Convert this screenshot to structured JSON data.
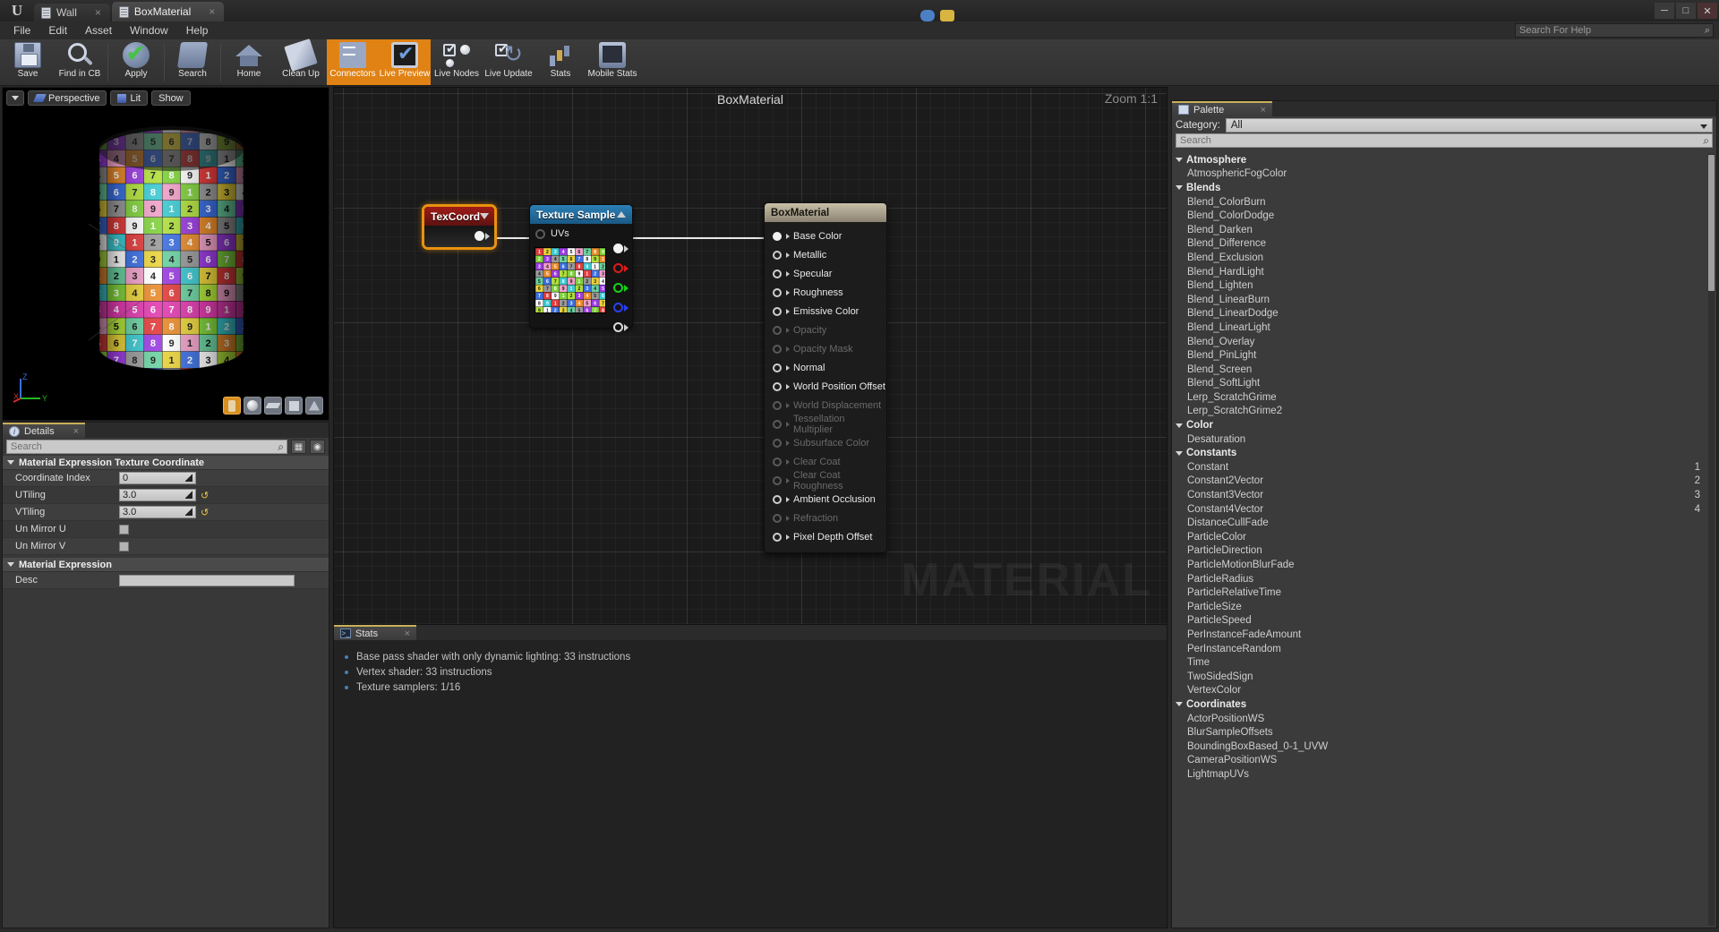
{
  "titlebar": {
    "logo": "ue-logo",
    "tabs": [
      {
        "label": "Wall",
        "close": "×",
        "active": false
      },
      {
        "label": "BoxMaterial",
        "close": "×",
        "active": true
      }
    ],
    "window_buttons": {
      "minimize": "─",
      "maximize": "□",
      "close": "✕"
    }
  },
  "menubar": {
    "items": [
      "File",
      "Edit",
      "Asset",
      "Window",
      "Help"
    ],
    "help_search_placeholder": "Search For Help",
    "help_search_value": ""
  },
  "toolbar": {
    "buttons": [
      {
        "label": "Save",
        "icon": "save-icon",
        "active": false
      },
      {
        "label": "Find in CB",
        "icon": "find-in-cb-icon",
        "active": false
      },
      {
        "label": "Apply",
        "icon": "apply-check-icon",
        "active": false
      },
      {
        "label": "Search",
        "icon": "search-binocular-icon",
        "active": false
      },
      {
        "label": "Home",
        "icon": "home-icon",
        "active": false
      },
      {
        "label": "Clean Up",
        "icon": "clean-up-broom-icon",
        "active": false
      },
      {
        "label": "Connectors",
        "icon": "connectors-icon",
        "active": true
      },
      {
        "label": "Live Preview",
        "icon": "live-preview-icon",
        "active": true
      },
      {
        "label": "Live Nodes",
        "icon": "live-nodes-icon",
        "active": false
      },
      {
        "label": "Live Update",
        "icon": "live-update-icon",
        "active": false
      },
      {
        "label": "Stats",
        "icon": "stats-bars-icon",
        "active": false
      },
      {
        "label": "Mobile Stats",
        "icon": "mobile-stats-icon",
        "active": false
      }
    ]
  },
  "viewport": {
    "view_mode_arrow": "view-options-arrow",
    "perspective_label": "Perspective",
    "lit_label": "Lit",
    "show_label": "Show",
    "axes": {
      "x": "X",
      "y": "Y",
      "z": "Z"
    },
    "preview_shapes": [
      "cylinder",
      "sphere",
      "plane",
      "cube",
      "custom-mesh"
    ]
  },
  "details": {
    "tab_title": "Details",
    "tab_close": "×",
    "search_placeholder": "Search",
    "groups": [
      {
        "title": "Material Expression Texture Coordinate",
        "props": [
          {
            "name": "Coordinate Index",
            "value": "0",
            "type": "number",
            "reset": false
          },
          {
            "name": "UTiling",
            "value": "3.0",
            "type": "number",
            "reset": true
          },
          {
            "name": "VTiling",
            "value": "3.0",
            "type": "number",
            "reset": true
          },
          {
            "name": "Un Mirror U",
            "value": "",
            "type": "checkbox",
            "reset": false
          },
          {
            "name": "Un Mirror V",
            "value": "",
            "type": "checkbox",
            "reset": false
          }
        ]
      },
      {
        "title": "Material Expression",
        "props": [
          {
            "name": "Desc",
            "value": "",
            "type": "text",
            "reset": false
          }
        ]
      }
    ]
  },
  "graph": {
    "title": "BoxMaterial",
    "zoom_label": "Zoom 1:1",
    "watermark": "MATERIAL",
    "nodes": {
      "texcoord": {
        "title": "TexCoord",
        "caret": "collapse-down",
        "selected": true
      },
      "texture_sample": {
        "title": "Texture Sample",
        "caret": "collapse-up",
        "input_pin": "UVs",
        "output_pins": [
          "RGB",
          "R",
          "G",
          "B",
          "A"
        ]
      },
      "box_material": {
        "title": "BoxMaterial",
        "pins": [
          {
            "label": "Base Color",
            "enabled": true,
            "connected": true
          },
          {
            "label": "Metallic",
            "enabled": true,
            "connected": false
          },
          {
            "label": "Specular",
            "enabled": true,
            "connected": false
          },
          {
            "label": "Roughness",
            "enabled": true,
            "connected": false
          },
          {
            "label": "Emissive Color",
            "enabled": true,
            "connected": false
          },
          {
            "label": "Opacity",
            "enabled": false,
            "connected": false
          },
          {
            "label": "Opacity Mask",
            "enabled": false,
            "connected": false
          },
          {
            "label": "Normal",
            "enabled": true,
            "connected": false
          },
          {
            "label": "World Position Offset",
            "enabled": true,
            "connected": false
          },
          {
            "label": "World Displacement",
            "enabled": false,
            "connected": false
          },
          {
            "label": "Tessellation Multiplier",
            "enabled": false,
            "connected": false
          },
          {
            "label": "Subsurface Color",
            "enabled": false,
            "connected": false
          },
          {
            "label": "Clear Coat",
            "enabled": false,
            "connected": false
          },
          {
            "label": "Clear Coat Roughness",
            "enabled": false,
            "connected": false
          },
          {
            "label": "Ambient Occlusion",
            "enabled": true,
            "connected": false
          },
          {
            "label": "Refraction",
            "enabled": false,
            "connected": false
          },
          {
            "label": "Pixel Depth Offset",
            "enabled": true,
            "connected": false
          }
        ]
      }
    }
  },
  "stats": {
    "tab_title": "Stats",
    "tab_close": "×",
    "lines": [
      "Base pass shader with only dynamic lighting: 33 instructions",
      "Vertex shader: 33 instructions",
      "Texture samplers: 1/16"
    ]
  },
  "palette": {
    "tab_title": "Palette",
    "tab_close": "×",
    "category_label": "Category:",
    "category_value": "All",
    "search_placeholder": "Search",
    "entries": [
      {
        "kind": "category",
        "label": "Atmosphere"
      },
      {
        "kind": "item",
        "label": "AtmosphericFogColor",
        "num": ""
      },
      {
        "kind": "category",
        "label": "Blends"
      },
      {
        "kind": "item",
        "label": "Blend_ColorBurn",
        "num": ""
      },
      {
        "kind": "item",
        "label": "Blend_ColorDodge",
        "num": ""
      },
      {
        "kind": "item",
        "label": "Blend_Darken",
        "num": ""
      },
      {
        "kind": "item",
        "label": "Blend_Difference",
        "num": ""
      },
      {
        "kind": "item",
        "label": "Blend_Exclusion",
        "num": ""
      },
      {
        "kind": "item",
        "label": "Blend_HardLight",
        "num": ""
      },
      {
        "kind": "item",
        "label": "Blend_Lighten",
        "num": ""
      },
      {
        "kind": "item",
        "label": "Blend_LinearBurn",
        "num": ""
      },
      {
        "kind": "item",
        "label": "Blend_LinearDodge",
        "num": ""
      },
      {
        "kind": "item",
        "label": "Blend_LinearLight",
        "num": ""
      },
      {
        "kind": "item",
        "label": "Blend_Overlay",
        "num": ""
      },
      {
        "kind": "item",
        "label": "Blend_PinLight",
        "num": ""
      },
      {
        "kind": "item",
        "label": "Blend_Screen",
        "num": ""
      },
      {
        "kind": "item",
        "label": "Blend_SoftLight",
        "num": ""
      },
      {
        "kind": "item",
        "label": "Lerp_ScratchGrime",
        "num": ""
      },
      {
        "kind": "item",
        "label": "Lerp_ScratchGrime2",
        "num": ""
      },
      {
        "kind": "category",
        "label": "Color"
      },
      {
        "kind": "item",
        "label": "Desaturation",
        "num": ""
      },
      {
        "kind": "category",
        "label": "Constants"
      },
      {
        "kind": "item",
        "label": "Constant",
        "num": "1"
      },
      {
        "kind": "item",
        "label": "Constant2Vector",
        "num": "2"
      },
      {
        "kind": "item",
        "label": "Constant3Vector",
        "num": "3"
      },
      {
        "kind": "item",
        "label": "Constant4Vector",
        "num": "4"
      },
      {
        "kind": "item",
        "label": "DistanceCullFade",
        "num": ""
      },
      {
        "kind": "item",
        "label": "ParticleColor",
        "num": ""
      },
      {
        "kind": "item",
        "label": "ParticleDirection",
        "num": ""
      },
      {
        "kind": "item",
        "label": "ParticleMotionBlurFade",
        "num": ""
      },
      {
        "kind": "item",
        "label": "ParticleRadius",
        "num": ""
      },
      {
        "kind": "item",
        "label": "ParticleRelativeTime",
        "num": ""
      },
      {
        "kind": "item",
        "label": "ParticleSize",
        "num": ""
      },
      {
        "kind": "item",
        "label": "ParticleSpeed",
        "num": ""
      },
      {
        "kind": "item",
        "label": "PerInstanceFadeAmount",
        "num": ""
      },
      {
        "kind": "item",
        "label": "PerInstanceRandom",
        "num": ""
      },
      {
        "kind": "item",
        "label": "Time",
        "num": ""
      },
      {
        "kind": "item",
        "label": "TwoSidedSign",
        "num": ""
      },
      {
        "kind": "item",
        "label": "VertexColor",
        "num": ""
      },
      {
        "kind": "category",
        "label": "Coordinates"
      },
      {
        "kind": "item",
        "label": "ActorPositionWS",
        "num": ""
      },
      {
        "kind": "item",
        "label": "BlurSampleOffsets",
        "num": ""
      },
      {
        "kind": "item",
        "label": "BoundingBoxBased_0-1_UVW",
        "num": ""
      },
      {
        "kind": "item",
        "label": "CameraPositionWS",
        "num": ""
      },
      {
        "kind": "item",
        "label": "LightmapUVs",
        "num": ""
      }
    ]
  },
  "colors": {
    "accent_orange": "#e08214",
    "node_texcoord_header": "#a01c18",
    "node_texsample_header": "#2c7fb5",
    "node_material_header": "#c8bfa8",
    "pin_red": "#e01b1b",
    "pin_green": "#14d214",
    "pin_blue": "#2a3ff0",
    "reset_arrow": "#e7c544",
    "panel_bg": "#3b3b3b",
    "graph_bg": "#1b1b1b"
  }
}
